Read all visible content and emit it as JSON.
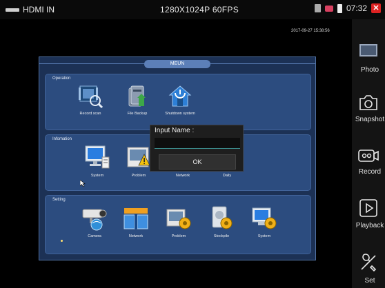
{
  "status_bar": {
    "input_label": "HDMI IN",
    "resolution": "1280X1024P 60FPS",
    "time": "07:32"
  },
  "video": {
    "timestamp": "2017-09-27 15:38:56"
  },
  "menu": {
    "title": "MEUN",
    "sections": [
      {
        "label": "Operation",
        "items": [
          {
            "label": "Record scan",
            "icon": "record-scan-icon"
          },
          {
            "label": "File Backup",
            "icon": "file-backup-icon"
          },
          {
            "label": "Shutdown system",
            "icon": "shutdown-system-icon"
          }
        ]
      },
      {
        "label": "Infomation",
        "items": [
          {
            "label": "System",
            "icon": "system-info-icon"
          },
          {
            "label": "Problem",
            "icon": "problem-info-icon"
          },
          {
            "label": "Network",
            "icon": "network-info-icon"
          },
          {
            "label": "Daily",
            "icon": "daily-info-icon"
          }
        ]
      },
      {
        "label": "Setting",
        "items": [
          {
            "label": "Camera",
            "icon": "camera-setting-icon"
          },
          {
            "label": "Network",
            "icon": "network-setting-icon"
          },
          {
            "label": "Problem",
            "icon": "problem-setting-icon"
          },
          {
            "label": "Stockpile",
            "icon": "stockpile-setting-icon"
          },
          {
            "label": "System",
            "icon": "system-setting-icon"
          }
        ]
      }
    ]
  },
  "dialog": {
    "title": "Input Name :",
    "input_value": "",
    "ok_label": "OK"
  },
  "side_panel": {
    "buttons": [
      {
        "label": "Photo",
        "icon": "photo-thumbnail-icon"
      },
      {
        "label": "Snapshot",
        "icon": "camera-icon"
      },
      {
        "label": "Record",
        "icon": "video-record-icon"
      },
      {
        "label": "Playback",
        "icon": "play-icon"
      },
      {
        "label": "Set",
        "icon": "tools-icon"
      }
    ]
  },
  "colors": {
    "menu_bg": "#1c3155",
    "section_bg": "#2c4c7f",
    "title_pill": "#5c7fb8",
    "close_red": "#dd2222"
  }
}
